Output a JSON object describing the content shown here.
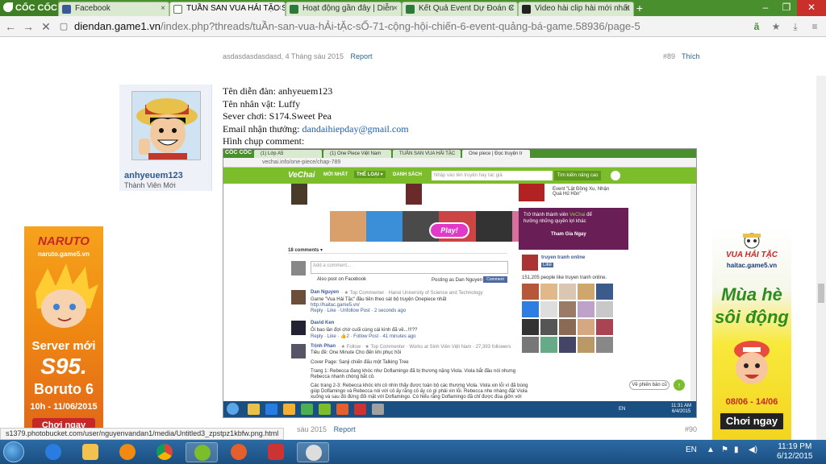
{
  "browser": {
    "brand": "CỐC CỐC",
    "tabs": [
      {
        "label": "Facebook",
        "icon": "facebook-icon"
      },
      {
        "label": "TUẦN SAN VUA HẢI TẶC S",
        "icon": "game-icon",
        "active": true
      },
      {
        "label": "Hoạt động gần đây | Diễn",
        "icon": "game-icon"
      },
      {
        "label": "Kết Quả Event Dự Đoán C",
        "icon": "game-icon"
      },
      {
        "label": "Video hài clip hài mới nhất",
        "icon": "video-icon"
      }
    ],
    "url_host": "diendan.game1.vn",
    "url_path": "/index.php?threads/tuẦn-san-vua-hẢi-tẶc-sỐ-71-cộng-hội-chiến-6-event-quảng-bá-game.58936/page-5",
    "colors": {
      "tabbar": "#4a8f2d",
      "accent": "#1a5fb4"
    }
  },
  "forum": {
    "prev_post": {
      "author": "asdasdasdasdasd",
      "date": "4 Tháng sáu 2015",
      "report": "Report",
      "number": "#89",
      "like": "Thích"
    },
    "user": {
      "name": "anhyeuem123",
      "rank": "Thành Viên Mới"
    },
    "post_lines": {
      "l1": "Tên diễn đàn: anhyeuem123",
      "l2": "Tên nhân vật: Luffy",
      "l3": "Sever chơi: S174.Sweet Pea",
      "l4_label": "Email nhận thưởng: ",
      "l4_email": "dandaihiepday@gmail.com",
      "l5": "Hình chụp comment:"
    },
    "next_post": {
      "date": "sáu 2015",
      "report": "Report",
      "number": "#90"
    }
  },
  "embedded": {
    "brand": "CỐC CỐC",
    "tabs": [
      "(1) Lớp A5",
      "(1) One Piece Việt Nam",
      "TUẦN SAN VUA HẢI TẶC",
      "One piece | Đọc truyện tr"
    ],
    "url": "vechai.info/one-piece/chap-789",
    "site": "VeChai",
    "nav": [
      "MỚI NHẤT",
      "THỂ LOẠI ▾",
      "DANH SÁCH"
    ],
    "search_placeholder": "Nhập vào tên truyện hay tác giả",
    "search_button": "Tìm kiếm nâng cao",
    "event_text": "Event \"Lật Đồng Xu, Nhận Quà Hủ Hồn\"",
    "play": "Play!",
    "comments_count": "18 comments ▾",
    "comment_placeholder": "Add a comment...",
    "also_post": "Also post on Facebook",
    "posting_as": "Posting as Dan Nguyen ▾",
    "comment_btn": "Comment",
    "comments": [
      {
        "name": "Dan Nguyen",
        "meta": "· ★ Top Commenter · Hanoi University of Science and Technology",
        "text": "Game \"Vua Hải Tặc\" đầu tiên theo sát bộ truyện Onepiece nhất",
        "link": "http://haitac.game5.vn/",
        "actions": "Reply · Like · Unfollow Post · 2 seconds ago"
      },
      {
        "name": "David Ken",
        "meta": "",
        "text": "Ôi bao lần đợi chờ cuối cùng cái kình đã về...!!!??",
        "link": "",
        "actions": "Reply · Like · 👍2 · Follow Post · 41 minutes ago"
      },
      {
        "name": "Trịnh Phan",
        "meta": "· ★ Follow · ★ Top Commenter · Works at Sinh Viên Việt Nam · 27,393 followers",
        "text": "Tiêu đề: One Minute Cho đến khi phục hồi",
        "link": "",
        "actions": ""
      }
    ],
    "body_lines": [
      "Cover Page: Sanji chiến đấu một Talking Tree",
      "Trang 1: Rebecca đang khóc như Doflamingo đã bị thương nặng Viola. Viola bắt đầu nói nhưng",
      "Rebecca nhanh chóng bắt cô.",
      "Các trang 2-3: Rebecca khóc khi cô nhìn thấy được toàn bộ các thương Viola. Viola xin lỗi vì đã bùng",
      "giúp Doflamingo và Rebecca nói với cô ấy rằng cô ấy có gì phải xin lỗi. Rebecca nhe nhàng đặt Viola",
      "xuống và sau đó đứng đối mặt với Doflamingo. Có hiểu rằng Doflamingo đã chỉ được đùa giỡn với"
    ],
    "promo_line1": "Trở thành thành viên ",
    "promo_brand": "VeChai",
    "promo_line1b": " để",
    "promo_line2": "hưởng những quyền lợi khác",
    "promo_button": "Tham Gia Ngay",
    "fb_page": "truyen tranh online",
    "fb_like": "Like",
    "fb_count": "151,205 people like truyen tranh online.",
    "chat_label": "Về phiên bản cũ",
    "taskbar_lang": "EN",
    "taskbar_time": "11:31 AM",
    "taskbar_date": "6/4/2015"
  },
  "ads": {
    "left": {
      "brand": "NARUTO",
      "site": "naruto.game5.vn",
      "line1": "Server mới",
      "line2": "S95.",
      "line3": "Boruto 6",
      "line4": "10h - 11/06/2015",
      "line5": "Chơi ngay"
    },
    "right": {
      "brand": "VUA HẢI TẶC",
      "site": "haitac.game5.vn",
      "line1": "Mùa hè",
      "line2": "sôi động",
      "line3": "08/06 - 14/06",
      "line4": "Chơi ngay"
    }
  },
  "status_url": "s1379.photobucket.com/user/nguyenvandan1/media/Untitled3_zpstpz1kbfw.png.html",
  "taskbar": {
    "lang": "EN",
    "time": "11:19 PM",
    "date": "6/12/2015"
  }
}
